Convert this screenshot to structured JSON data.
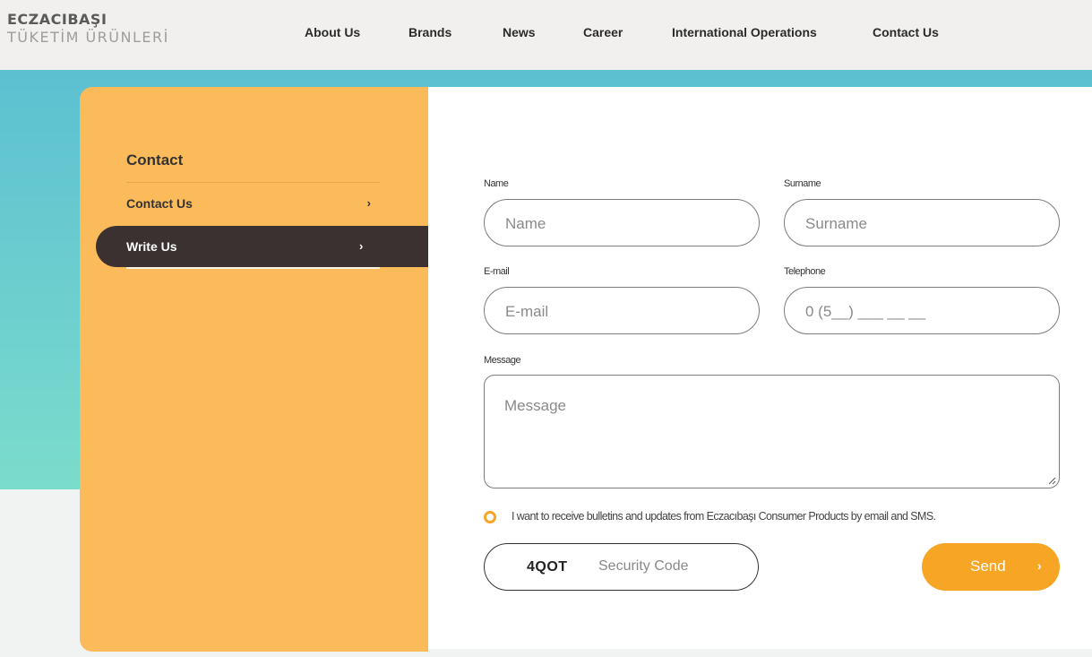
{
  "header": {
    "logo_line1": "ECZACIBAŞI",
    "logo_line2": "TÜKETİM ÜRÜNLERİ",
    "nav": [
      "About Us",
      "Brands",
      "News",
      "Career",
      "International Operations",
      "Contact Us"
    ]
  },
  "sidebar": {
    "title": "Contact",
    "items": [
      {
        "label": "Contact Us",
        "chevron": "›"
      },
      {
        "label": "Write Us",
        "chevron": "›",
        "active": true
      }
    ]
  },
  "form": {
    "name": {
      "label": "Name",
      "placeholder": "Name"
    },
    "surname": {
      "label": "Surname",
      "placeholder": "Surname"
    },
    "email": {
      "label": "E-mail",
      "placeholder": "E-mail"
    },
    "telephone": {
      "label": "Telephone",
      "placeholder": "0 (5__) ___ __ __"
    },
    "message": {
      "label": "Message",
      "placeholder": "Message"
    },
    "consent_text": "I want to receive bulletins and updates from Eczacıbaşı Consumer Products by email and SMS.",
    "security_code": "4QOT",
    "security_placeholder": "Security Code",
    "send_label": "Send",
    "send_chevron": "›"
  },
  "colors": {
    "accent_orange": "#f7a524",
    "sidebar_orange": "#fcbb5a",
    "active_item_bg": "#3a3130",
    "hero_top": "#5cc0d1",
    "hero_bottom": "#7bdccc"
  }
}
